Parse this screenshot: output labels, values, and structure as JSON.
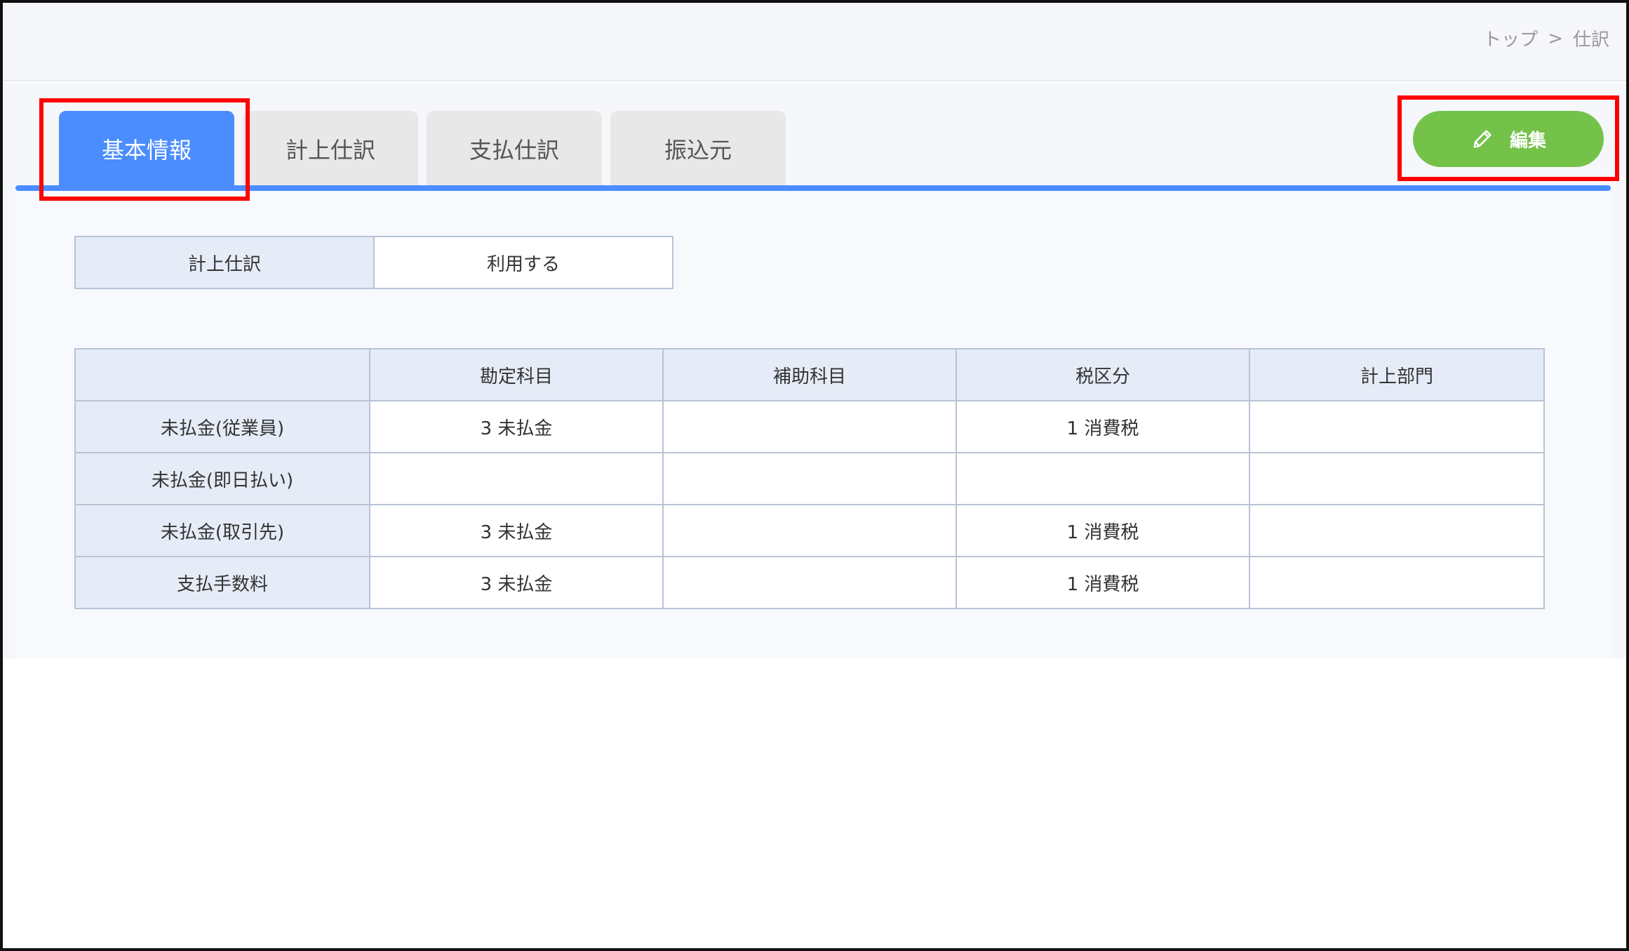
{
  "breadcrumb": {
    "home": "トップ",
    "separator": ">",
    "current": "仕訳"
  },
  "tabs": [
    {
      "label": "基本情報",
      "active": true
    },
    {
      "label": "計上仕訳",
      "active": false
    },
    {
      "label": "支払仕訳",
      "active": false
    },
    {
      "label": "振込元",
      "active": false
    }
  ],
  "edit_button": {
    "label": "編集",
    "icon": "pencil-icon",
    "color": "#74c24a"
  },
  "setting": {
    "label": "計上仕訳",
    "value": "利用する"
  },
  "journal_table": {
    "headers": [
      "",
      "勘定科目",
      "補助科目",
      "税区分",
      "計上部門"
    ],
    "rows": [
      {
        "name": "未払金(従業員)",
        "account": "3 未払金",
        "sub_account": "",
        "tax": "1 消費税",
        "department": ""
      },
      {
        "name": "未払金(即日払い)",
        "account": "",
        "sub_account": "",
        "tax": "",
        "department": ""
      },
      {
        "name": "未払金(取引先)",
        "account": "3 未払金",
        "sub_account": "",
        "tax": "1 消費税",
        "department": ""
      },
      {
        "name": "支払手数料",
        "account": "3 未払金",
        "sub_account": "",
        "tax": "1 消費税",
        "department": ""
      }
    ]
  },
  "colors": {
    "accent": "#4b8dff",
    "highlight": "#ff0000",
    "header_bg": "#e6ecf7"
  }
}
